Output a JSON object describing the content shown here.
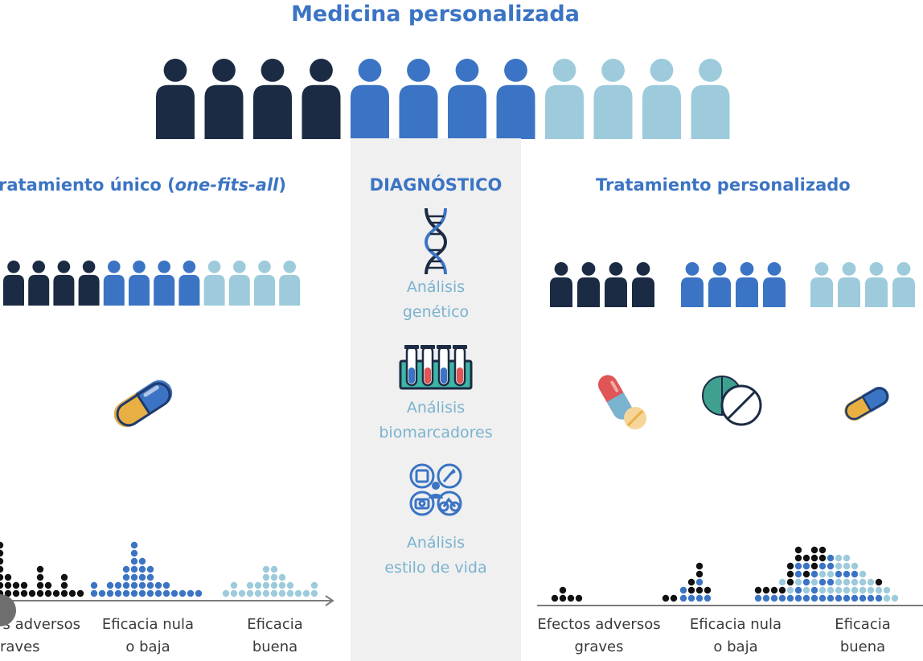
{
  "title": "Medicina personalizada",
  "colors": {
    "title": "#3b74c4",
    "dark": "#1c2b44",
    "blue": "#3b74c4",
    "light": "#9dcbdb",
    "center_text": "#7ab3cf",
    "background_band": "#f0f0f0"
  },
  "left": {
    "heading_prefix": "ratamiento único (",
    "heading_italic": "one-fits-all",
    "heading_suffix": ")",
    "axis_labels": [
      {
        "line1": "s adversos",
        "line2": "raves"
      },
      {
        "line1": "Eficacia nula",
        "line2": "o baja"
      },
      {
        "line1": "Eficacia",
        "line2": "buena"
      }
    ]
  },
  "center": {
    "heading": "DIAGNÓSTICO",
    "items": [
      {
        "icon": "dna-icon",
        "line1": "Análisis",
        "line2": "genético"
      },
      {
        "icon": "test-tubes-icon",
        "line1": "Análisis",
        "line2": "biomarcadores"
      },
      {
        "icon": "lifestyle-icon",
        "line1": "Análisis",
        "line2": "estilo de vida"
      }
    ]
  },
  "right": {
    "heading": "Tratamiento personalizado",
    "axis_labels": [
      {
        "line1": "Efectos adversos",
        "line2": "graves"
      },
      {
        "line1": "Eficacia nula",
        "line2": "o baja"
      },
      {
        "line1": "Eficacia",
        "line2": "buena"
      }
    ]
  }
}
